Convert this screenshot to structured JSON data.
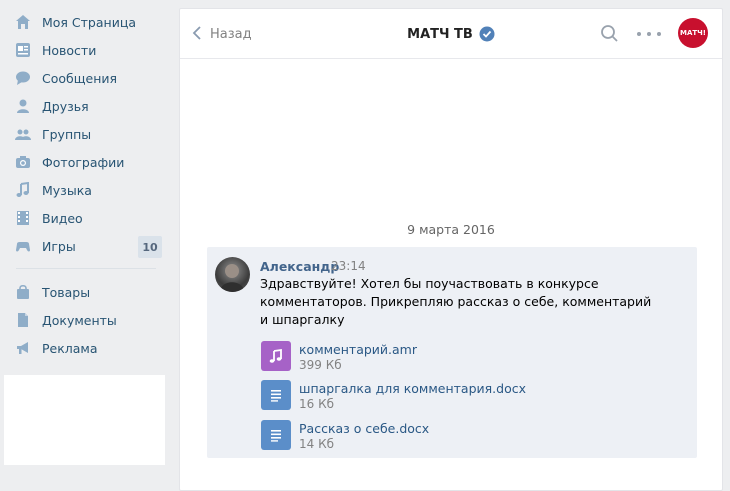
{
  "sidebar": {
    "items": [
      {
        "label": "Моя Страница",
        "icon": "home-icon"
      },
      {
        "label": "Новости",
        "icon": "news-icon"
      },
      {
        "label": "Сообщения",
        "icon": "messages-icon"
      },
      {
        "label": "Друзья",
        "icon": "friends-icon"
      },
      {
        "label": "Группы",
        "icon": "groups-icon"
      },
      {
        "label": "Фотографии",
        "icon": "camera-icon"
      },
      {
        "label": "Музыка",
        "icon": "music-icon"
      },
      {
        "label": "Видео",
        "icon": "video-icon"
      },
      {
        "label": "Игры",
        "icon": "games-icon",
        "badge": "10"
      },
      {
        "label": "Товары",
        "icon": "bag-icon"
      },
      {
        "label": "Документы",
        "icon": "document-icon"
      },
      {
        "label": "Реклама",
        "icon": "megaphone-icon"
      }
    ]
  },
  "header": {
    "back_label": "Назад",
    "title": "МАТЧ ТВ",
    "logo_text": "МАТЧ!"
  },
  "conversation": {
    "date": "9 марта 2016",
    "message": {
      "author": "Александр",
      "time": "23:14",
      "text": "Здравствуйте! Хотел бы поучаствовать в конкурсе комментаторов. Прикрепляю рассказ о себе, комментарий и шпаргалку",
      "attachments": [
        {
          "name": "комментарий.amr",
          "size": "399 Кб",
          "type": "audio"
        },
        {
          "name": "шпаргалка для комментария.docx",
          "size": "16 Кб",
          "type": "document"
        },
        {
          "name": "Рассказ о себе.docx",
          "size": "14 Кб",
          "type": "document"
        }
      ]
    }
  },
  "colors": {
    "link": "#2a5885",
    "nav_text": "#285473",
    "verified": "#5181b8",
    "audio_icon": "#a662c7",
    "doc_icon": "#5b8ec9",
    "logo_bg": "#c8102e"
  }
}
